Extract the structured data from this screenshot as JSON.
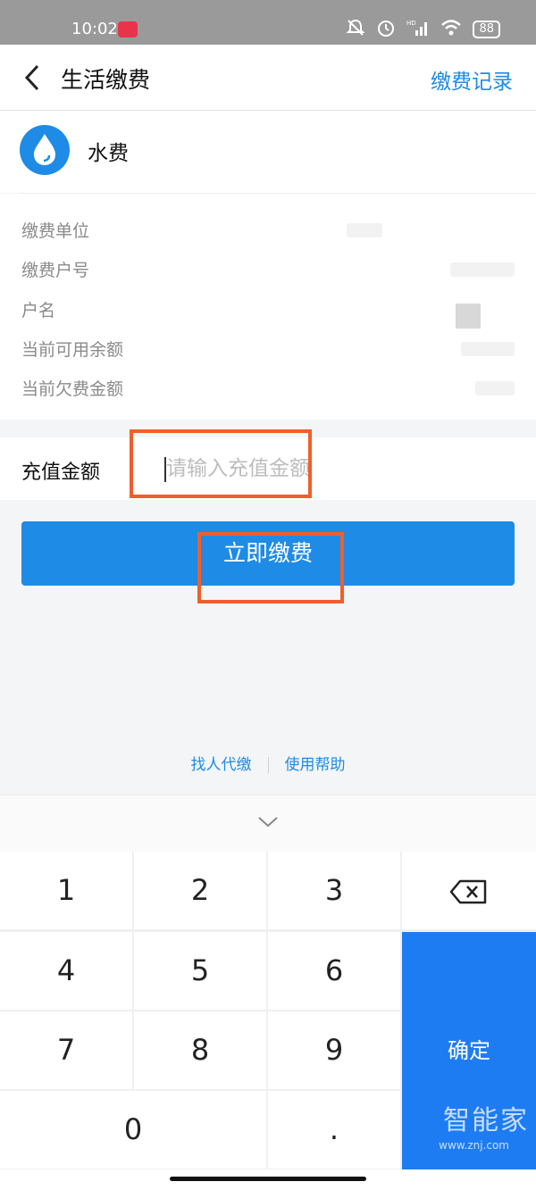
{
  "status_bar": {
    "time": "10:02",
    "battery": "88",
    "network": "HD"
  },
  "header": {
    "title": "生活缴费",
    "records_link": "缴费记录"
  },
  "biller": {
    "name": "水费",
    "icon": "water-drop-icon"
  },
  "info": {
    "rows": [
      "缴费单位",
      "缴费户号",
      "户名",
      "当前可用余额",
      "当前欠费金额"
    ]
  },
  "amount": {
    "label": "充值金额",
    "placeholder": "请输入充值金额"
  },
  "pay_button": "立即缴费",
  "links": {
    "proxy_pay": "找人代缴",
    "help": "使用帮助"
  },
  "keyboard": {
    "keys": [
      "1",
      "2",
      "3",
      "4",
      "5",
      "6",
      "7",
      "8",
      "9",
      "0",
      "."
    ],
    "confirm": "确定"
  },
  "watermark": {
    "logo": "智能家",
    "url": "www.znj.com"
  },
  "colors": {
    "accent": "#1e8be6",
    "highlight": "#f05f2a",
    "confirm": "#1e7cf3"
  }
}
